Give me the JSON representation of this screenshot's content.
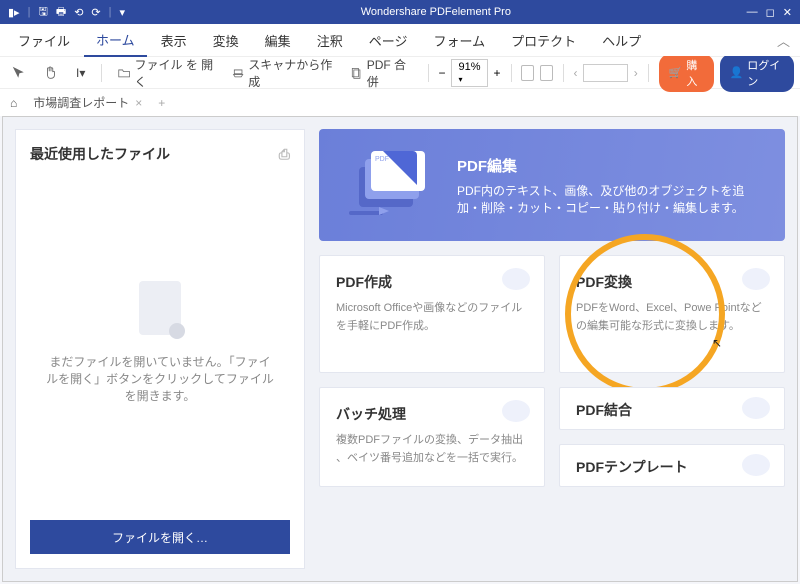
{
  "titlebar": {
    "app": "Wondershare PDFelement Pro"
  },
  "menu": {
    "file": "ファイル",
    "home": "ホーム",
    "view": "表示",
    "convert": "変換",
    "edit": "編集",
    "annotate": "注釈",
    "page": "ページ",
    "form": "フォーム",
    "protect": "プロテクト",
    "help": "ヘルプ"
  },
  "toolbar": {
    "open": "ファイル を 開く",
    "scan": "スキャナから作成",
    "merge": "PDF 合併",
    "zoom": "91%",
    "buy": "購入",
    "login": "ログイン"
  },
  "tabs": {
    "doc": "市場調査レポート"
  },
  "left": {
    "title": "最近使用したファイル",
    "empty": "まだファイルを開いていません。「ファイルを開く」ボタンをクリックしてファイルを開きます。",
    "open": "ファイルを開く…"
  },
  "hero": {
    "title": "PDF編集",
    "desc": "PDF内のテキスト、画像、及び他のオブジェクトを追加・削除・カット・コピー・貼り付け・編集します。"
  },
  "cards": {
    "create": {
      "title": "PDF作成",
      "desc": "Microsoft Officeや画像などのファイルを手軽にPDF作成。"
    },
    "convert": {
      "title": "PDF変換",
      "desc": "PDFをWord、Excel、Powe Pointなどの編集可能な形式に変換します。"
    },
    "batch": {
      "title": "バッチ処理",
      "desc": "複数PDFファイルの変換、データ抽出 、ベイツ番号追加などを一括で実行。"
    },
    "combine": {
      "title": "PDF結合"
    },
    "template": {
      "title": "PDFテンプレート"
    }
  }
}
